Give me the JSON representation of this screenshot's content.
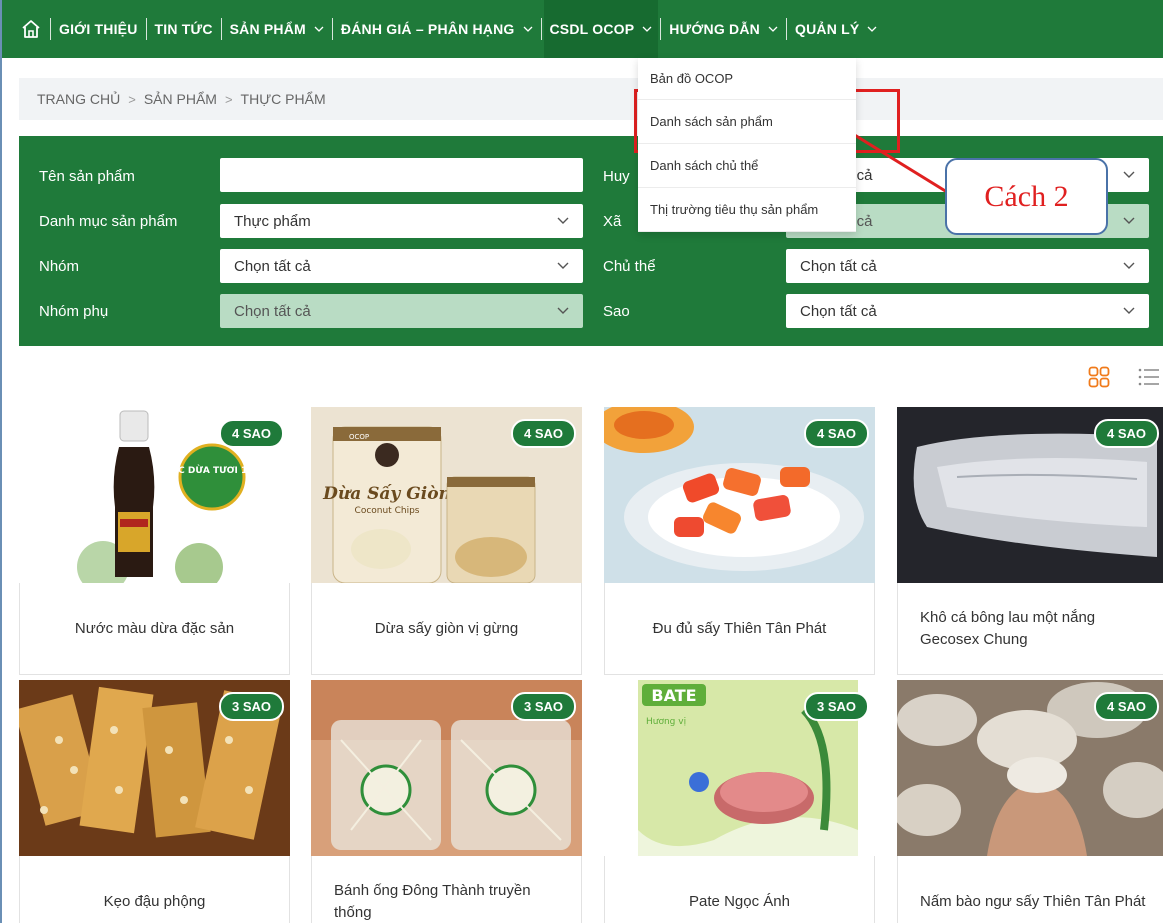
{
  "nav": {
    "items": [
      {
        "label": "GIỚI THIỆU",
        "has_dropdown": false
      },
      {
        "label": "TIN TỨC",
        "has_dropdown": false
      },
      {
        "label": "SẢN PHẨM",
        "has_dropdown": true
      },
      {
        "label": "ĐÁNH GIÁ – PHÂN HẠNG",
        "has_dropdown": true
      },
      {
        "label": "CSDL OCOP",
        "has_dropdown": true
      },
      {
        "label": "HƯỚNG DẪN",
        "has_dropdown": true
      },
      {
        "label": "QUẢN LÝ",
        "has_dropdown": true
      }
    ],
    "home_icon": "home-icon",
    "color": "#1f7a3a"
  },
  "dropdown": {
    "items": [
      "Bản đồ OCOP",
      "Danh sách sản phẩm",
      "Danh sách chủ thể",
      "Thị trường tiêu thụ sản phẩm"
    ]
  },
  "breadcrumb": [
    "TRANG CHỦ",
    "SẢN PHẨM",
    "THỰC PHẨM"
  ],
  "filters": {
    "ten_san_pham": {
      "label": "Tên sản phẩm",
      "value": ""
    },
    "danh_muc": {
      "label": "Danh mục sản phẩm",
      "value": "Thực phẩm"
    },
    "nhom": {
      "label": "Nhóm",
      "value": "Chọn tất cả"
    },
    "nhom_phu": {
      "label": "Nhóm phụ",
      "value": "Chọn tất cả"
    },
    "huyen": {
      "label": "Huyện",
      "label_visible": "Huy",
      "value": "ất cả"
    },
    "xa": {
      "label": "Xã",
      "value": "ất cả"
    },
    "chu_the": {
      "label": "Chủ thể",
      "value": "Chọn tất cả"
    },
    "sao": {
      "label": "Sao",
      "value": "Chọn tất cả"
    }
  },
  "view_icons": {
    "grid": "grid-view-icon",
    "list": "list-view-icon"
  },
  "annotation": {
    "callout": "Cách 2"
  },
  "products": [
    {
      "name": "Nước màu dừa đặc sản",
      "badge": "4 SAO"
    },
    {
      "name": "Dừa sấy giòn vị gừng",
      "badge": "4 SAO"
    },
    {
      "name": "Đu đủ sấy Thiên Tân Phát",
      "badge": "4 SAO"
    },
    {
      "name": "Khô cá bông lau một nắng Gecosex Chung",
      "badge": "4 SAO"
    },
    {
      "name": "Kẹo đậu phộng",
      "badge": "3 SAO"
    },
    {
      "name": "Bánh ống Đông Thành truyền thống",
      "badge": "3 SAO"
    },
    {
      "name": "Pate Ngọc Ánh",
      "badge": "3 SAO"
    },
    {
      "name": "Nấm bào ngư sấy Thiên Tân Phát",
      "badge": "4 SAO"
    }
  ],
  "image_texts": {
    "p1_label": "NƯỚC DỪA TƯƠI 100%",
    "p2_brand": "Dừa Sấy Giòn",
    "p2_sub": "Coconut Chips",
    "p2_ocop": "OCOP",
    "p7_brand": "BATE",
    "p7_sub": "Hương vị"
  }
}
